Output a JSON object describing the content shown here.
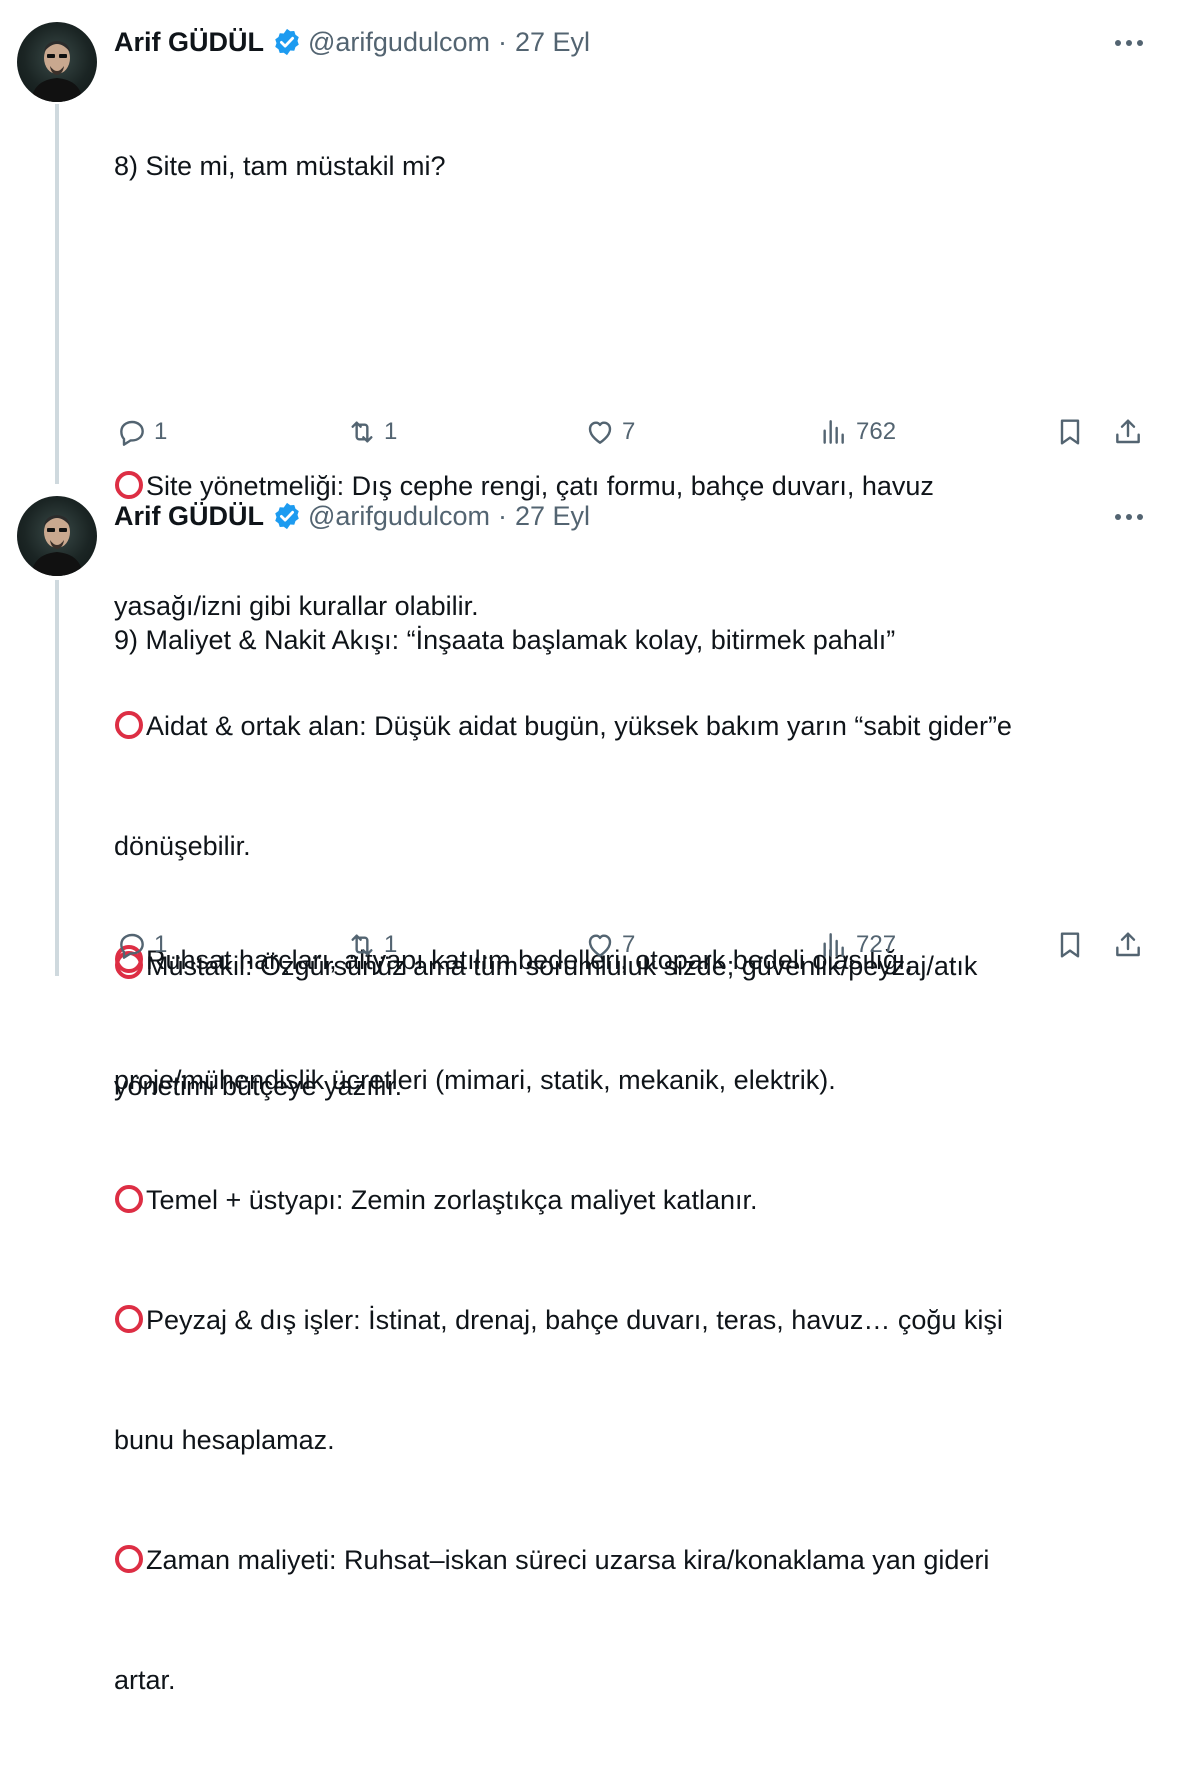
{
  "tweets": [
    {
      "author": {
        "name": "Arif GÜDÜL",
        "handle": "@arifgudulcom",
        "date": "27 Eyl",
        "separator": "·"
      },
      "lines": [
        "8) Site mi, tam müstakil mi?",
        "",
        "",
        "Site yönetmeliği: Dış cephe rengi, çatı formu, bahçe duvarı, havuz",
        "yasağı/izni gibi kurallar olabilir.",
        "Aidat & ortak alan: Düşük aidat bugün, yüksek bakım yarın “sabit gider”e",
        "dönüşebilir.",
        "Müstakil: Özgürsünüz ama tüm sorumluluk sizde; güvenlik/peyzaj/atık",
        "yönetimi bütçeye yazılır."
      ],
      "bullet_lines": [
        3,
        5,
        7
      ],
      "stats": {
        "replies": "1",
        "reposts": "1",
        "likes": "7",
        "views": "762"
      }
    },
    {
      "author": {
        "name": "Arif GÜDÜL",
        "handle": "@arifgudulcom",
        "date": "27 Eyl",
        "separator": "·"
      },
      "lines": [
        "9) Maliyet & Nakit Akışı: “İnşaata başlamak kolay, bitirmek pahalı”",
        "",
        "",
        "Ruhsat harçları, altyapı katılım bedelleri, otopark bedeli olasılığı,",
        "proje/mühendislik ücretleri (mimari, statik, mekanik, elektrik).",
        "Temel + üstyapı: Zemin zorlaştıkça maliyet katlanır.",
        "Peyzaj & dış işler: İstinat, drenaj, bahçe duvarı, teras, havuz… çoğu kişi",
        "bunu hesaplamaz.",
        "Zaman maliyeti: Ruhsat–iskan süreci uzarsa kira/konaklama yan gideri",
        "artar."
      ],
      "bullet_lines": [
        3,
        5,
        6,
        8
      ],
      "stats": {
        "replies": "1",
        "reposts": "1",
        "likes": "7",
        "views": "727"
      }
    }
  ],
  "icons": {
    "verified": "verified-badge-icon",
    "more": "more-icon",
    "reply": "reply-icon",
    "repost": "repost-icon",
    "like": "heart-icon",
    "views": "views-icon",
    "bookmark": "bookmark-icon",
    "share": "share-icon",
    "bullet": "red-circle-icon"
  },
  "colors": {
    "text": "#0f1419",
    "secondary": "#536471",
    "verified": "#1d9bf0",
    "thread_line": "#cfd9de",
    "bullet": "#dd2e44"
  }
}
